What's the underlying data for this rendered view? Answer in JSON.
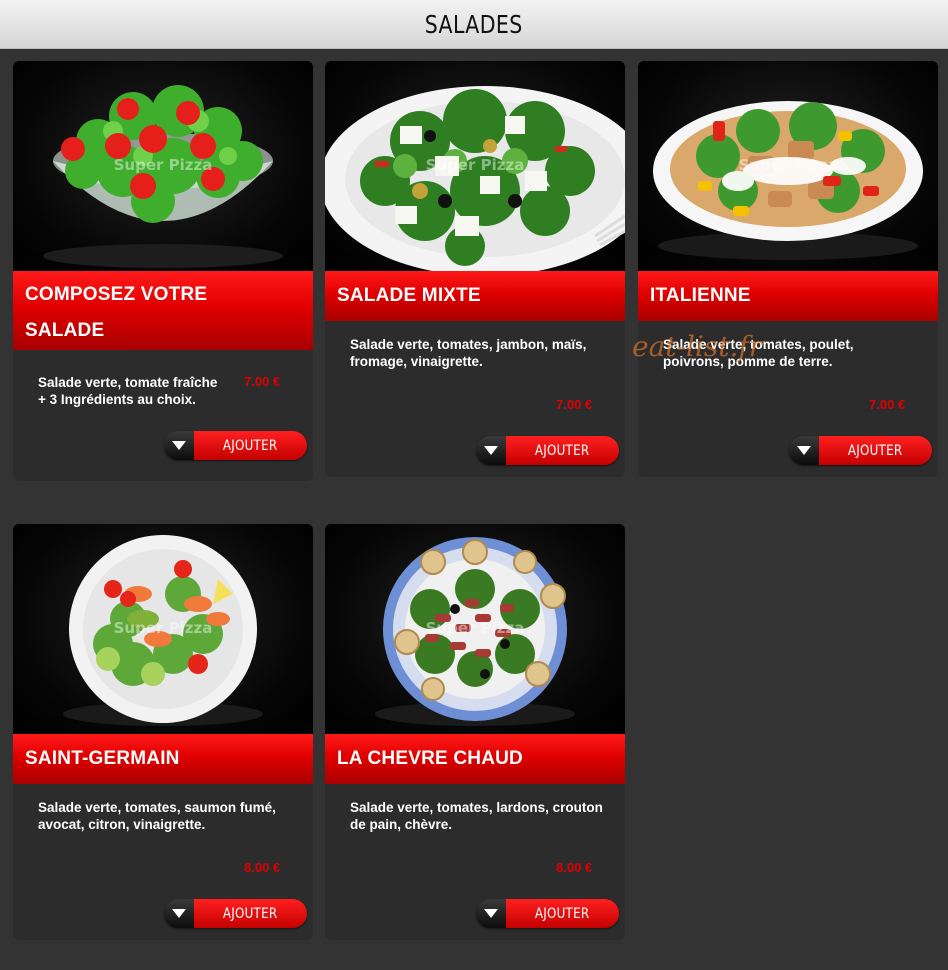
{
  "page": {
    "title": "SALADES",
    "site_watermark": "eat-list.fr"
  },
  "colors": {
    "accent": "#e00000",
    "background": "#333333",
    "card": "#2c2c2c"
  },
  "products": [
    {
      "name_line1": "COMPOSEZ VOTRE",
      "name_line2": "SALADE",
      "desc_line1": "Salade verte, tomate fraîche",
      "desc_line2": "+ 3 Ingrédients au choix.",
      "price": "7.00 €",
      "button": "AJOUTER",
      "photo_watermark": "Super Pizza"
    },
    {
      "name_line1": "SALADE MIXTE",
      "desc_line1": "Salade verte, tomates, jambon, maïs,",
      "desc_line2": "fromage, vinaigrette.",
      "price": "7.00 €",
      "button": "AJOUTER",
      "photo_watermark": "Super Pizza"
    },
    {
      "name_line1": "ITALIENNE",
      "desc_line1": "Salade verte, tomates, poulet,",
      "desc_line2": "poivrons, pomme de terre.",
      "price": "7.00 €",
      "button": "AJOUTER",
      "photo_watermark": "Super Pizza"
    },
    {
      "name_line1": "SAINT-GERMAIN",
      "desc_line1": "Salade verte, tomates, saumon fumé,",
      "desc_line2": "avocat, citron, vinaigrette.",
      "price": "8.00 €",
      "button": "AJOUTER",
      "photo_watermark": "Super Pizza"
    },
    {
      "name_line1": "LA CHEVRE CHAUD",
      "desc_line1": "Salade verte, tomates, lardons, crouton",
      "desc_line2": "de pain, chèvre.",
      "price": "8.00 €",
      "button": "AJOUTER",
      "photo_watermark": "Super Pizza"
    }
  ],
  "icons": {
    "button_arrow": "caret-down-icon"
  }
}
